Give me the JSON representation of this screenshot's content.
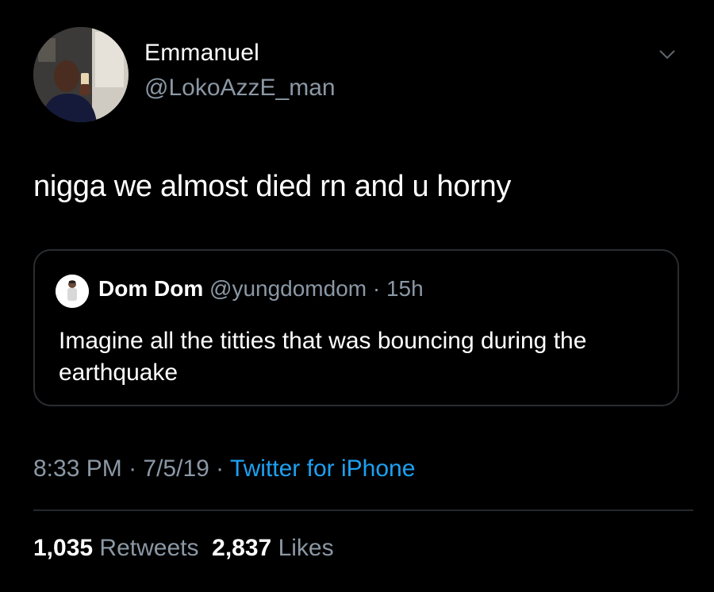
{
  "author": {
    "display_name": "Emmanuel",
    "handle": "@LokoAzzE_man",
    "avatar_icon": "profile-photo"
  },
  "tweet": {
    "text": "nigga we almost died rn and u horny"
  },
  "quoted_tweet": {
    "display_name": "Dom Dom",
    "handle": "@yungdomdom",
    "separator": " · ",
    "time_ago": "15h",
    "text": "Imagine all the titties that was bouncing during the earthquake",
    "avatar_icon": "profile-photo"
  },
  "meta": {
    "time": "8:33 PM",
    "separator": " · ",
    "date": "7/5/19",
    "source": "Twitter for iPhone"
  },
  "stats": {
    "retweets_count": "1,035",
    "retweets_label": "Retweets",
    "likes_count": "2,837",
    "likes_label": "Likes"
  },
  "colors": {
    "background": "#000000",
    "primary_text": "#ffffff",
    "secondary_text": "#8b98a5",
    "link": "#1da1f2",
    "border": "#2a2d31"
  },
  "icons": {
    "menu": "chevron-down-icon"
  }
}
